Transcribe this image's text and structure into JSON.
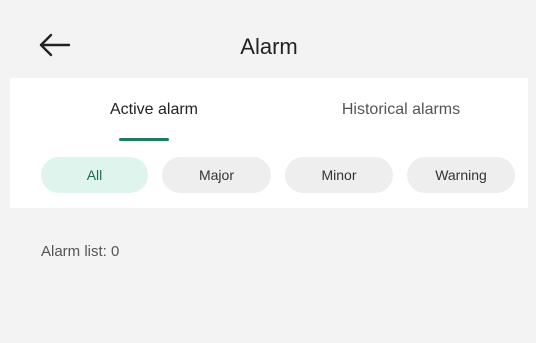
{
  "header": {
    "title": "Alarm"
  },
  "tabs": [
    {
      "label": "Active alarm",
      "selected": true
    },
    {
      "label": "Historical alarms",
      "selected": false
    }
  ],
  "filters": [
    {
      "label": "All",
      "selected": true
    },
    {
      "label": "Major",
      "selected": false
    },
    {
      "label": "Minor",
      "selected": false
    },
    {
      "label": "Warning",
      "selected": false
    }
  ],
  "alarm_list": {
    "count_text": "Alarm list: 0"
  },
  "colors": {
    "accent": "#1e7a63",
    "chip_selected_bg": "#def4ec",
    "chip_bg": "#eeeeee",
    "page_bg": "#f3f3f3"
  },
  "icons": {
    "back": "arrow-left-icon"
  }
}
